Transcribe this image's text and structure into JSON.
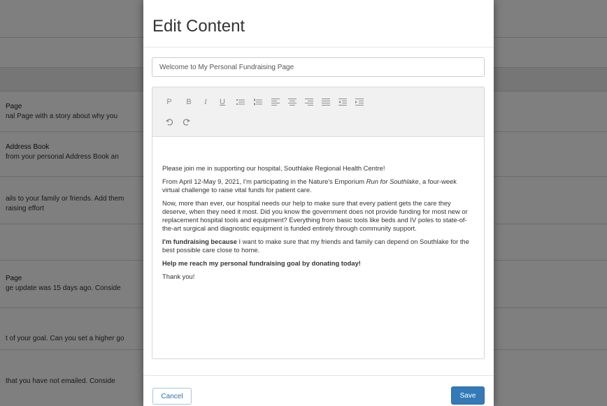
{
  "background": {
    "rows": [
      {
        "title": "",
        "desc": ""
      },
      {
        "title": "Page",
        "desc": "nal Page with a story about why you"
      },
      {
        "title": "Address Book",
        "desc": "from your personal Address Book an"
      },
      {
        "title": "",
        "desc": "ails to your family or friends. Add them"
      },
      {
        "title": "",
        "desc": "raising effort"
      },
      {
        "title": "Page",
        "desc": "ge update was 15 days ago. Conside"
      },
      {
        "title": "",
        "desc": "t of your goal. Can you set a higher go"
      },
      {
        "title": "",
        "desc": "that you have not emailed. Conside"
      }
    ]
  },
  "modal": {
    "title": "Edit Content",
    "page_title_value": "Welcome to My Personal Fundraising Page",
    "toolbar": {
      "paragraph": "P",
      "bold": "B",
      "italic": "I",
      "underline": "U"
    },
    "body": {
      "p1": "Please join me in supporting our hospital, Southlake Regional Health Centre!",
      "p2_before": "From April 12-May 9, 2021, I'm participating in the Nature's Emporium ",
      "p2_italic": "Run for Southlake",
      "p2_after": ", a four-week virtual challenge to raise vital funds for patient care.",
      "p3": "Now, more than ever, our hospital needs our help to make sure that every patient gets the care they deserve, when they need it most. Did you know the government does not provide funding for most new or replacement hospital tools and equipment? Everything from basic tools like beds and IV poles to state-of-the-art surgical and diagnostic equipment is funded entirely through community support.",
      "p4_bold": "I'm fundraising because",
      "p4_rest": " I want to make sure that my friends and family can depend on Southlake for the best possible care close to home.",
      "p5": "Help me reach my personal fundraising goal by donating today!",
      "p6": "Thank you!"
    },
    "cancel_label": "Cancel",
    "save_label": "Save"
  },
  "colors": {
    "primary": "#337ab7",
    "toolbar_bg": "#f1f1f1",
    "overlay": "rgba(0,0,0,0.5)"
  }
}
